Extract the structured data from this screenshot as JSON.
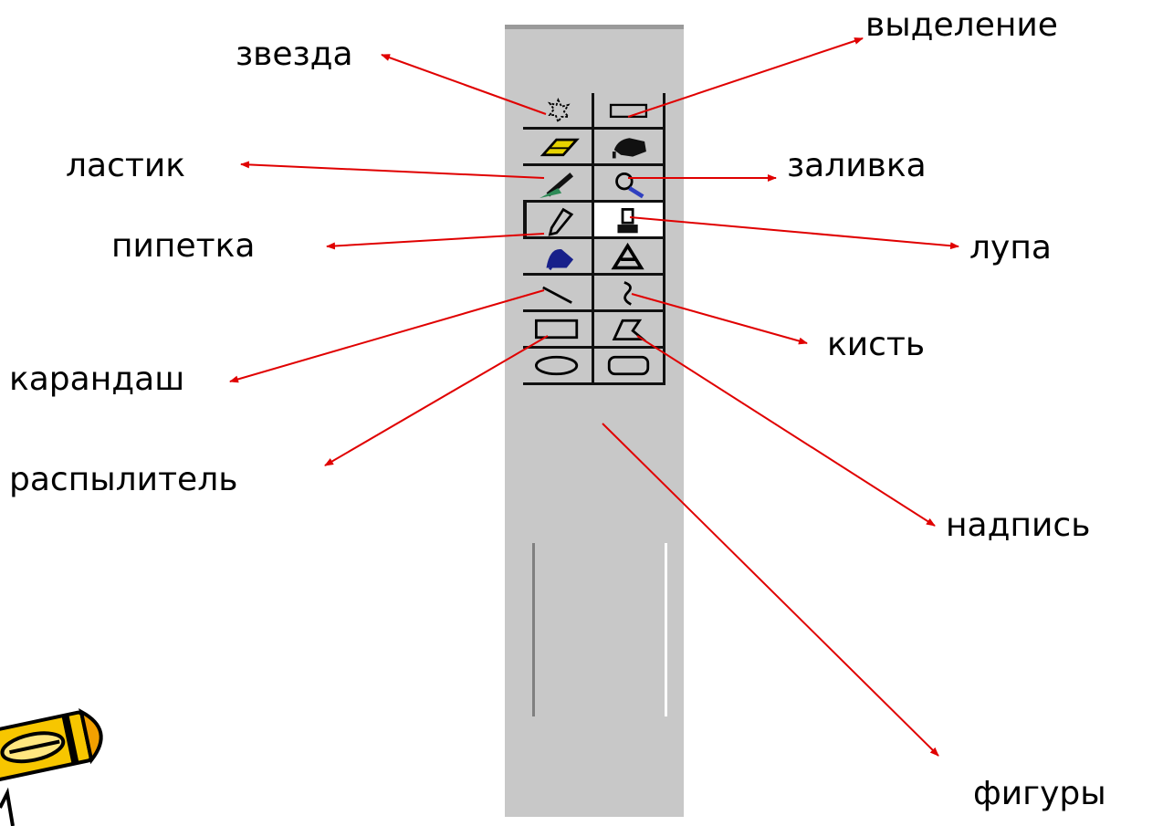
{
  "labels": {
    "star": "звезда",
    "select": "выделение",
    "eraser": "ластик",
    "fill": "заливка",
    "pipette": "пипетка",
    "magnifier": "лупа",
    "brush": "кисть",
    "pencil": "карандаш",
    "sprayer": "распылитель",
    "text": "надпись",
    "shapes": "фигуры"
  },
  "toolbar": {
    "tools": [
      "star",
      "select",
      "eraser",
      "fill",
      "pipette",
      "magnifier",
      "pencil",
      "brush",
      "sprayer",
      "text",
      "line",
      "curve",
      "rectangle",
      "polygon",
      "ellipse",
      "rounded-rectangle"
    ]
  },
  "colors": {
    "arrow": "#e00000",
    "toolbar": "#c8c8c8",
    "pencil_clipart": "#f7c600"
  }
}
